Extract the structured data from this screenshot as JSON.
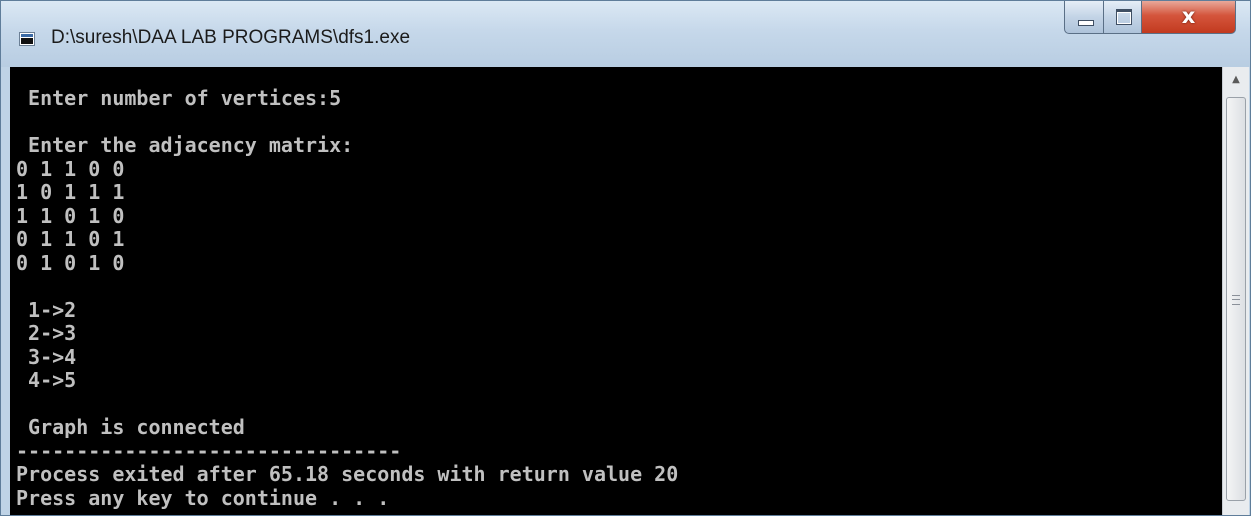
{
  "window": {
    "title": "D:\\suresh\\DAA LAB PROGRAMS\\dfs1.exe",
    "icon": "console-app-icon",
    "controls": {
      "minimize_icon": "minimize-icon",
      "maximize_icon": "maximize-icon",
      "close_label": "x"
    }
  },
  "console": {
    "output": " Enter number of vertices:5\n\n Enter the adjacency matrix:\n0 1 1 0 0\n1 0 1 1 1\n1 1 0 1 0\n0 1 1 0 1\n0 1 0 1 0\n\n 1->2\n 2->3\n 3->4\n 4->5\n\n Graph is connected\n--------------------------------\nProcess exited after 65.18 seconds with return value 20\nPress any key to continue . . .",
    "text_color": "#c0c0c0",
    "background": "#000000"
  },
  "scrollbar": {
    "up_arrow_icon": "scroll-up-arrow-icon",
    "up_arrow_glyph": "▲"
  }
}
